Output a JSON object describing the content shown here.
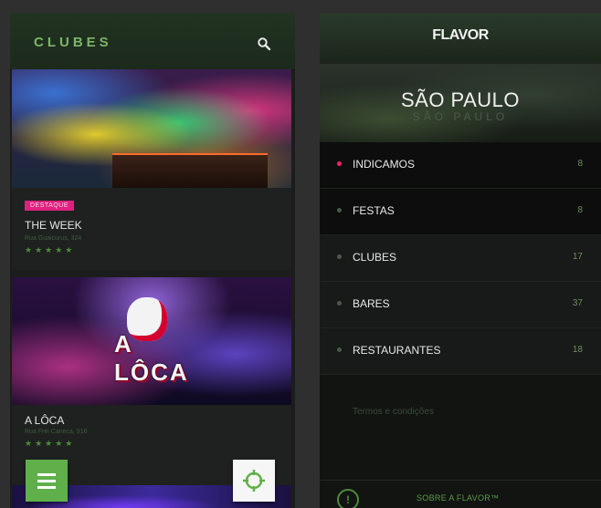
{
  "left_screen": {
    "header": {
      "title": "CLUBES",
      "search_icon": "search-icon"
    },
    "cards": [
      {
        "badge": "DESTAQUE",
        "name": "THE WEEK",
        "address": "Rua Guaicurus, 324",
        "stars": "★★★★★"
      },
      {
        "badge": "",
        "name": "A LÔCA",
        "address": "Rua Frei Caneca, 916",
        "stars": "★★★★★",
        "logo_text": "A LÔCA"
      }
    ],
    "fab_menu_icon": "hamburger-icon",
    "fab_locate_icon": "crosshair-icon"
  },
  "right_screen": {
    "logo": "FLAVOR",
    "city": {
      "name": "SÃO PAULO",
      "reflection": "SÃO PAULO"
    },
    "menu": [
      {
        "label": "INDICAMOS",
        "count": "8",
        "active": true
      },
      {
        "label": "FESTAS",
        "count": "8",
        "active": false
      },
      {
        "label": "CLUBES",
        "count": "17",
        "active": false
      },
      {
        "label": "BARES",
        "count": "37",
        "active": false
      },
      {
        "label": "RESTAURANTES",
        "count": "18",
        "active": false
      }
    ],
    "terms": "Termos e condições",
    "about": "SOBRE A FLAVOR™",
    "info_icon": "!"
  },
  "colors": {
    "accent_green": "#5fb04a",
    "accent_pink": "#e0207e",
    "background": "#1b1d1c"
  }
}
